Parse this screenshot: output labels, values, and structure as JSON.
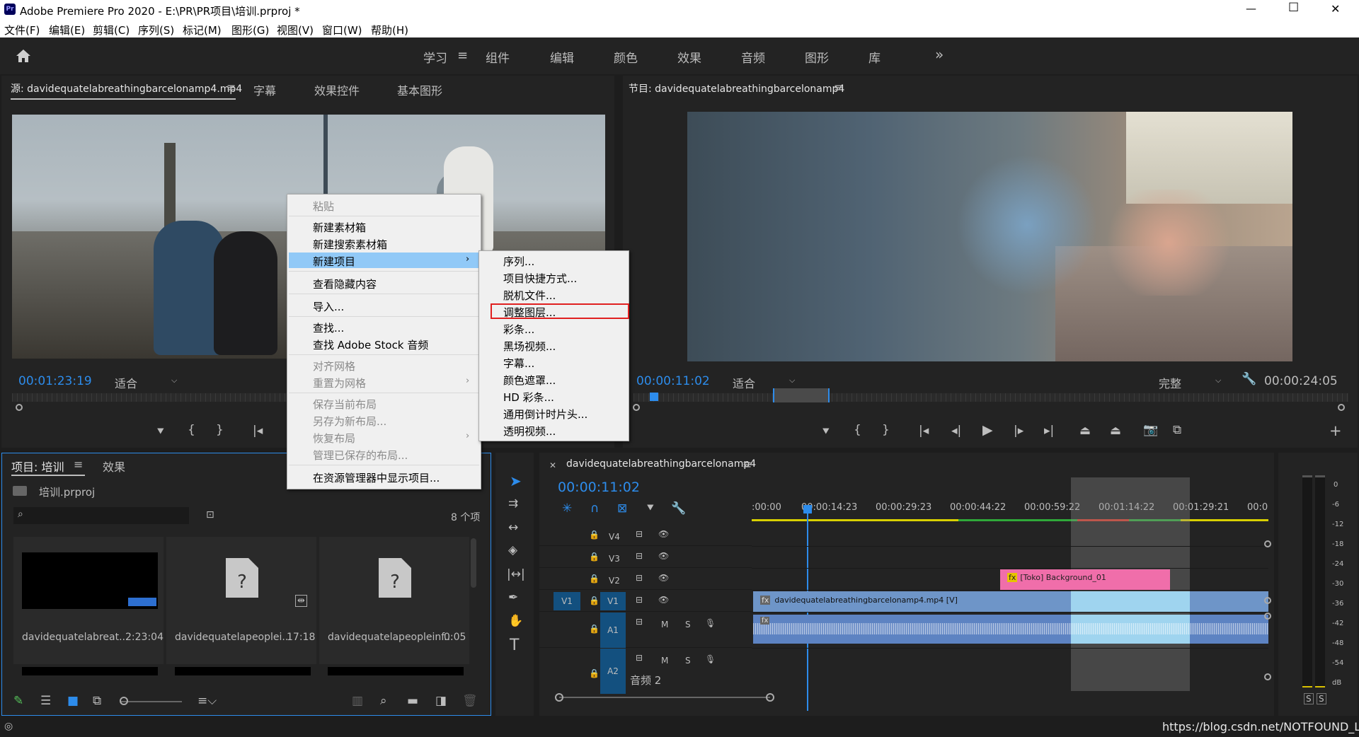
{
  "window": {
    "title": "Adobe Premiere Pro 2020 - E:\\PR\\PR项目\\培训.prproj *",
    "app_icon": "Pr",
    "controls": [
      "—",
      "☐",
      "✕"
    ]
  },
  "menu": [
    "文件(F)",
    "编辑(E)",
    "剪辑(C)",
    "序列(S)",
    "标记(M)",
    "图形(G)",
    "视图(V)",
    "窗口(W)",
    "帮助(H)"
  ],
  "workspaces": {
    "items": [
      "学习",
      "组件",
      "编辑",
      "颜色",
      "效果",
      "音频",
      "图形",
      "库"
    ],
    "active": "学习",
    "more": "»"
  },
  "source_panel": {
    "tabs": [
      "源: davidequatelabreathingbarcelonamp4.mp4",
      "字幕",
      "效果控件",
      "基本图形"
    ],
    "timecode": "00:01:23:19",
    "fit": "适合"
  },
  "program_panel": {
    "tab": "节目: davidequatelabreathingbarcelonamp4",
    "timecode": "00:00:11:02",
    "fit": "适合",
    "quality": "完整",
    "duration": "00:00:24:05"
  },
  "project_panel": {
    "tabs": [
      "项目: 培训",
      "效果"
    ],
    "file": "培训.prproj",
    "count": "8 个项",
    "items": [
      {
        "name": "davidequatelabreat...",
        "duration": "2:23:04"
      },
      {
        "name": "davidequatelapeoplei...",
        "duration": "17:18"
      },
      {
        "name": "davidequatelapeopleinf...",
        "duration": "0:05"
      }
    ]
  },
  "context_menu": {
    "items": [
      {
        "label": "粘贴",
        "disabled": true
      },
      {
        "label": "新建素材箱",
        "disabled": false
      },
      {
        "label": "新建搜索素材箱",
        "disabled": false
      },
      {
        "label": "新建项目",
        "disabled": false,
        "highlighted": true,
        "submenu": true
      },
      {
        "label": "查看隐藏内容",
        "disabled": false
      },
      {
        "label": "导入...",
        "disabled": false
      },
      {
        "label": "查找...",
        "disabled": false
      },
      {
        "label": "查找 Adobe Stock 音频",
        "disabled": false
      },
      {
        "label": "对齐网格",
        "disabled": true
      },
      {
        "label": "重置为网格",
        "disabled": true,
        "submenu": true
      },
      {
        "label": "保存当前布局",
        "disabled": true
      },
      {
        "label": "另存为新布局...",
        "disabled": true
      },
      {
        "label": "恢复布局",
        "disabled": true,
        "submenu": true
      },
      {
        "label": "管理已保存的布局...",
        "disabled": true
      },
      {
        "label": "在资源管理器中显示项目...",
        "disabled": false
      }
    ]
  },
  "submenu": {
    "items": [
      "序列...",
      "项目快捷方式...",
      "脱机文件...",
      "调整图层...",
      "彩条...",
      "黑场视频...",
      "字幕...",
      "颜色遮罩...",
      "HD 彩条...",
      "通用倒计时片头...",
      "透明视频..."
    ],
    "boxed": "调整图层..."
  },
  "timeline": {
    "tab": "davidequatelabreathingbarcelonamp4",
    "timecode": "00:00:11:02",
    "ruler": [
      ":00:00",
      "00:00:14:23",
      "00:00:29:23",
      "00:00:44:22",
      "00:00:59:22",
      "00:01:14:22",
      "00:01:29:21",
      "00:0"
    ],
    "tracks": [
      "V4",
      "V3",
      "V2",
      "V1",
      "A1",
      "A2"
    ],
    "source_patch_v": "V1",
    "audio2_label": "音频 2",
    "clips": {
      "v2": "[Toko] Background_01",
      "v1": "davidequatelabreathingbarcelonamp4.mp4 [V]"
    }
  },
  "meter": {
    "scale": [
      "0",
      "-6",
      "-12",
      "-18",
      "-24",
      "-30",
      "-36",
      "-42",
      "-48",
      "-54",
      "dB"
    ],
    "buttons": [
      "S",
      "S"
    ]
  },
  "watermark": "https://blog.csdn.net/NOTFOUND_Liu",
  "colors": {
    "accent": "#2d8ceb",
    "pink_clip": "#f06eaa",
    "video_clip": "#6e95c8",
    "audio_clip": "#5d83c2"
  }
}
